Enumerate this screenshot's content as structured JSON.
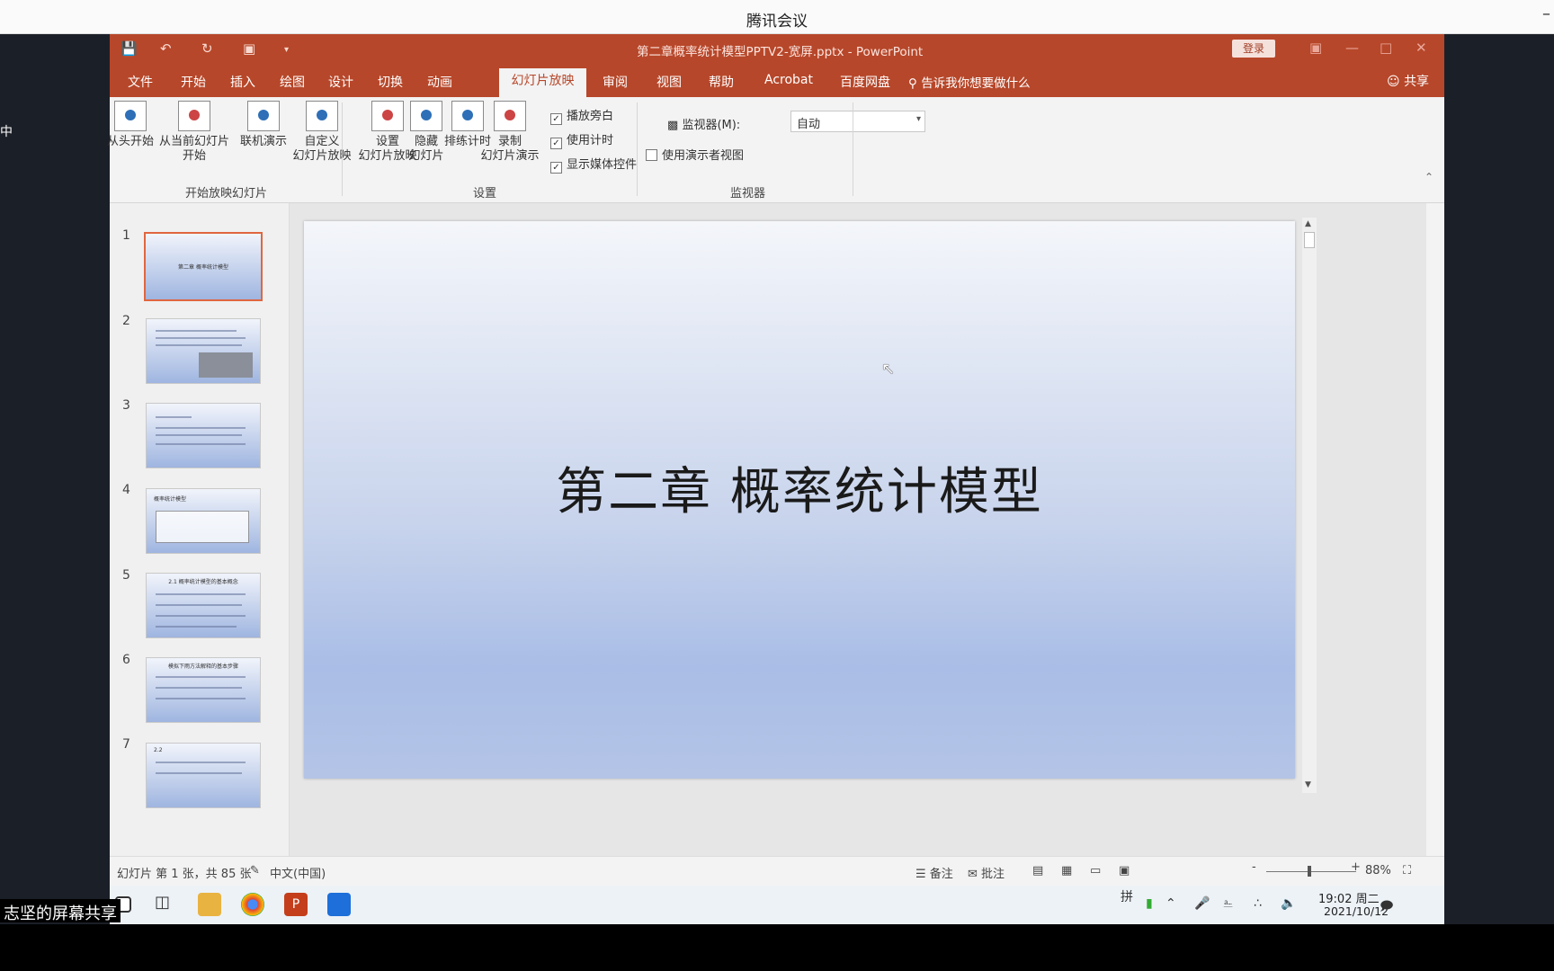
{
  "meeting": {
    "title": "腾讯会议",
    "minimize": "–"
  },
  "left_strip_text": "中",
  "share_caption": "志坚的屏幕共享",
  "ppt": {
    "doc_title": "第二章概率统计模型PPTV2-宽屏.pptx  -  PowerPoint",
    "login": "登录",
    "tabs": [
      "文件",
      "开始",
      "插入",
      "绘图",
      "设计",
      "切换",
      "动画",
      "幻灯片放映",
      "审阅",
      "视图",
      "帮助",
      "Acrobat",
      "百度网盘"
    ],
    "active_tab": "幻灯片放映",
    "tell_me": "告诉我你想要做什么",
    "share": "共享",
    "ribbon": {
      "start": {
        "from_beginning": "从头开始",
        "from_current_1": "从当前幻灯片",
        "from_current_2": "开始",
        "online": "联机演示",
        "custom_1": "自定义",
        "custom_2": "幻灯片放映",
        "group_label": "开始放映幻灯片"
      },
      "setup": {
        "setup_1": "设置",
        "setup_2": "幻灯片放映",
        "hide_1": "隐藏",
        "hide_2": "幻灯片",
        "rehearse": "排练计时",
        "record_1": "录制",
        "record_2": "幻灯片演示",
        "play_narration": "播放旁白",
        "use_timings": "使用计时",
        "show_media": "显示媒体控件",
        "group_label": "设置"
      },
      "monitors": {
        "monitor_label": "监视器(M):",
        "monitor_value": "自动",
        "presenter_view": "使用演示者视图",
        "group_label": "监视器"
      }
    },
    "thumbnails": [
      {
        "num": "1",
        "title": "第二章 概率统计模型"
      },
      {
        "num": "2"
      },
      {
        "num": "3"
      },
      {
        "num": "4",
        "title": "概率统计模型"
      },
      {
        "num": "5",
        "title": "2.1 概率统计模型的基本概念"
      },
      {
        "num": "6",
        "title": "模拟下雨方法解释的基本步骤"
      },
      {
        "num": "7",
        "title": "2.2"
      }
    ],
    "slide_title": "第二章  概率统计模型",
    "status": {
      "slide_info": "幻灯片 第 1 张，共 85 张",
      "language": "中文(中国)",
      "notes": "备注",
      "comments": "批注",
      "zoom": "88%"
    }
  },
  "taskbar": {
    "time": "19:02 周二",
    "date": "2021/10/12",
    "ime": "拼"
  }
}
